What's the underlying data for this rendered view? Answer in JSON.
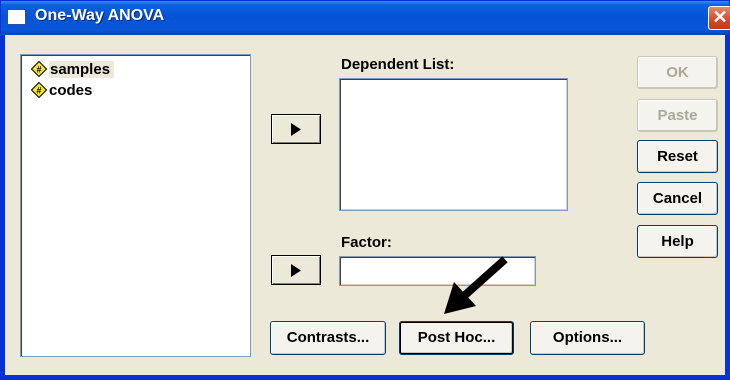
{
  "window": {
    "title": "One-Way ANOVA",
    "close_glyph": "✕"
  },
  "variables": [
    {
      "name": "samples",
      "icon": "scale-variable-icon",
      "selected": true
    },
    {
      "name": "codes",
      "icon": "scale-variable-icon",
      "selected": false
    }
  ],
  "labels": {
    "dependent_list": "Dependent List:",
    "factor": "Factor:"
  },
  "factor_field": {
    "value": ""
  },
  "side_buttons": {
    "ok": "OK",
    "paste": "Paste",
    "reset": "Reset",
    "cancel": "Cancel",
    "help": "Help"
  },
  "bottom_buttons": {
    "contrasts": "Contrasts...",
    "post_hoc": "Post Hoc...",
    "options": "Options..."
  },
  "colors": {
    "title_bar": "#0453d6",
    "dialog_bg": "#ece9d8",
    "disabled_text": "#aca899",
    "variable_icon_fill": "#f6e23a"
  }
}
